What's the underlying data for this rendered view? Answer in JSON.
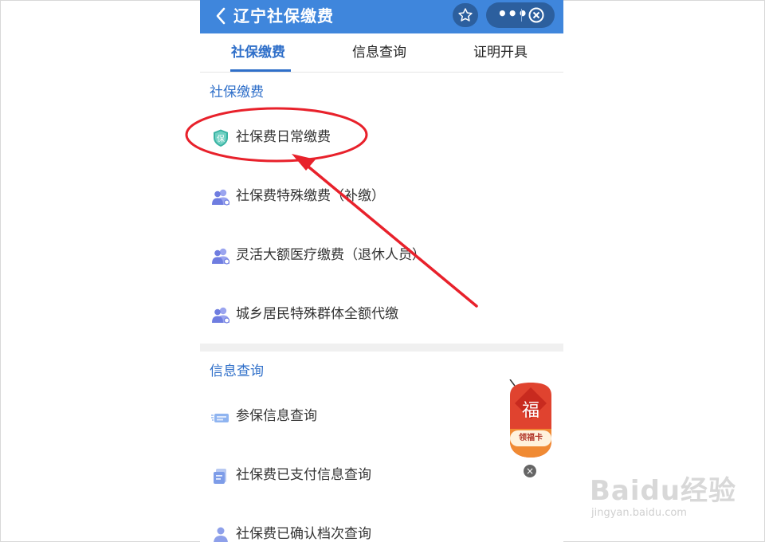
{
  "app": {
    "title": "辽宁社保缴费",
    "more_label": "•••"
  },
  "tabs": [
    {
      "label": "社保缴费",
      "active": true
    },
    {
      "label": "信息查询",
      "active": false
    },
    {
      "label": "证明开具",
      "active": false
    }
  ],
  "sections": [
    {
      "title": "社保缴费",
      "items": [
        {
          "label": "社保费日常缴费",
          "icon": "shield-bao-icon"
        },
        {
          "label": "社保费特殊缴费（补缴）",
          "icon": "people-icon"
        },
        {
          "label": "灵活大额医疗缴费（退休人员）",
          "icon": "people-icon"
        },
        {
          "label": "城乡居民特殊群体全额代缴",
          "icon": "people-icon"
        }
      ]
    },
    {
      "title": "信息查询",
      "items": [
        {
          "label": "参保信息查询",
          "icon": "card-icon"
        },
        {
          "label": "社保费已支付信息查询",
          "icon": "document-icon"
        },
        {
          "label": "社保费已确认档次查询",
          "icon": "person-icon"
        }
      ]
    }
  ],
  "promo": {
    "glyph": "福",
    "badge": "领福卡",
    "close": "×"
  },
  "watermark": {
    "brand": "Baidu经验",
    "url": "jingyan.baidu.com"
  },
  "colors": {
    "titlebar": "#3f86dc",
    "accent": "#2f6fc9",
    "annotation": "#e8212b",
    "promo": "#d9372a"
  }
}
